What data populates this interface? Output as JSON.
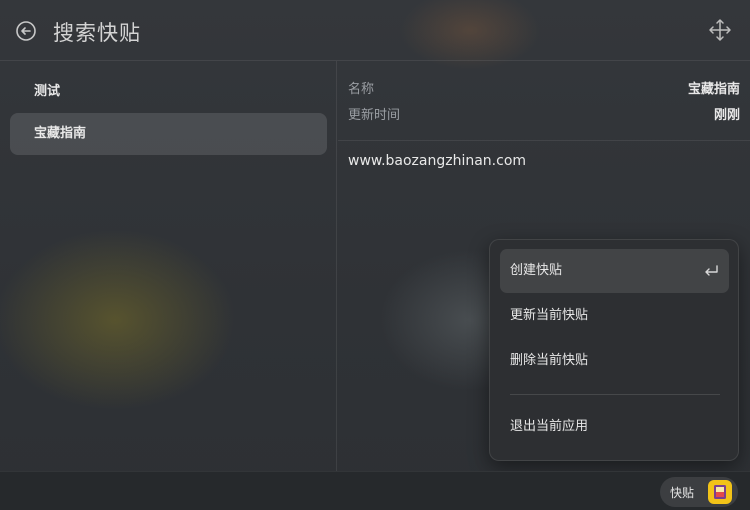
{
  "header": {
    "title": "搜索快贴"
  },
  "list": {
    "items": [
      {
        "label": "测试"
      },
      {
        "label": "宝藏指南"
      }
    ]
  },
  "detail": {
    "name_label": "名称",
    "name_value": "宝藏指南",
    "updated_label": "更新时间",
    "updated_value": "刚刚",
    "content": "www.baozangzhinan.com"
  },
  "menu": {
    "create": "创建快贴",
    "update": "更新当前快贴",
    "delete": "删除当前快贴",
    "exit": "退出当前应用"
  },
  "footer": {
    "app_label": "快贴"
  },
  "colors": {
    "app_icon": "#f2c318",
    "menu_bg": "#2d2f32"
  }
}
